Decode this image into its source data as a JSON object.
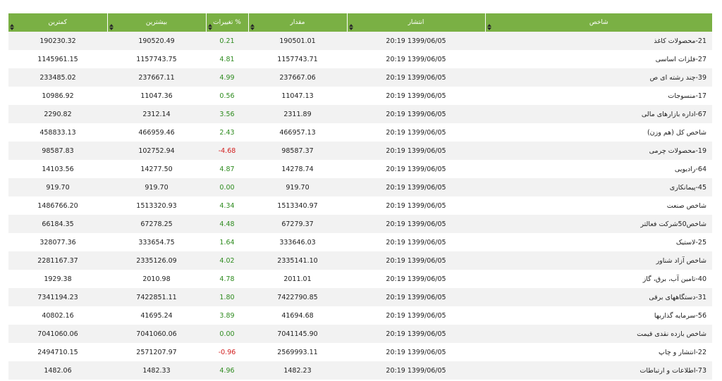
{
  "colors": {
    "header_bg": "#7ab044",
    "header_text": "#ffffff",
    "row_odd": "#f2f2f2",
    "row_even": "#ffffff",
    "positive": "#2e8b1f",
    "negative": "#d21f1f"
  },
  "table": {
    "headers": {
      "name": "شاخص",
      "published": "انتشار",
      "value": "مقدار",
      "change": "% تغییرات",
      "max": "بیشترین",
      "min": "کمترین"
    },
    "rows": [
      {
        "name": "21-محصولات کاغذ",
        "published": "20:19 1399/06/05",
        "value": "190501.01",
        "change": "0.21",
        "trend": "pos",
        "max": "190520.49",
        "min": "190230.32"
      },
      {
        "name": "27-فلزات اساسی",
        "published": "20:19 1399/06/05",
        "value": "1157743.71",
        "change": "4.81",
        "trend": "pos",
        "max": "1157743.75",
        "min": "1145961.15"
      },
      {
        "name": "39-چند رشته ای ص",
        "published": "20:19 1399/06/05",
        "value": "237667.06",
        "change": "4.99",
        "trend": "pos",
        "max": "237667.11",
        "min": "233485.02"
      },
      {
        "name": "17-منسوجات",
        "published": "20:19 1399/06/05",
        "value": "11047.13",
        "change": "0.56",
        "trend": "pos",
        "max": "11047.36",
        "min": "10986.92"
      },
      {
        "name": "67-اداره بازارهای مالی",
        "published": "20:19 1399/06/05",
        "value": "2311.89",
        "change": "3.56",
        "trend": "pos",
        "max": "2312.14",
        "min": "2290.82"
      },
      {
        "name": "شاخص کل (هم وزن)",
        "published": "20:19 1399/06/05",
        "value": "466957.13",
        "change": "2.43",
        "trend": "pos",
        "max": "466959.46",
        "min": "458833.13"
      },
      {
        "name": "19-محصولات چرمی",
        "published": "20:19 1399/06/05",
        "value": "98587.37",
        "change": "4.68-",
        "trend": "neg",
        "max": "102752.94",
        "min": "98587.83"
      },
      {
        "name": "64-رادیویی",
        "published": "20:19 1399/06/05",
        "value": "14278.74",
        "change": "4.87",
        "trend": "pos",
        "max": "14277.50",
        "min": "14103.56"
      },
      {
        "name": "45-پیمانکاری",
        "published": "20:19 1399/06/05",
        "value": "919.70",
        "change": "0.00",
        "trend": "zero",
        "max": "919.70",
        "min": "919.70"
      },
      {
        "name": "شاخص صنعت",
        "published": "20:19 1399/06/05",
        "value": "1513340.97",
        "change": "4.34",
        "trend": "pos",
        "max": "1513320.93",
        "min": "1486766.20"
      },
      {
        "name": "شاخص50شرکت فعالتر",
        "published": "20:19 1399/06/05",
        "value": "67279.37",
        "change": "4.48",
        "trend": "pos",
        "max": "67278.25",
        "min": "66184.35"
      },
      {
        "name": "25-لاستیک",
        "published": "20:19 1399/06/05",
        "value": "333646.03",
        "change": "1.64",
        "trend": "pos",
        "max": "333654.75",
        "min": "328077.36"
      },
      {
        "name": "شاخص آزاد شناور",
        "published": "20:19 1399/06/05",
        "value": "2335141.10",
        "change": "4.02",
        "trend": "pos",
        "max": "2335126.09",
        "min": "2281167.37"
      },
      {
        "name": "40-تامین آب، برق، گاز",
        "published": "20:19 1399/06/05",
        "value": "2011.01",
        "change": "4.78",
        "trend": "pos",
        "max": "2010.98",
        "min": "1929.38"
      },
      {
        "name": "31-دستگاههای برقی",
        "published": "20:19 1399/06/05",
        "value": "7422790.85",
        "change": "1.80",
        "trend": "pos",
        "max": "7422851.11",
        "min": "7341194.23"
      },
      {
        "name": "56-سرمایه گذاریها",
        "published": "20:19 1399/06/05",
        "value": "41694.68",
        "change": "3.89",
        "trend": "pos",
        "max": "41695.24",
        "min": "40802.16"
      },
      {
        "name": "شاخص بازده نقدی قیمت",
        "published": "20:19 1399/06/05",
        "value": "7041145.90",
        "change": "0.00",
        "trend": "zero",
        "max": "7041060.06",
        "min": "7041060.06"
      },
      {
        "name": "22-انتشار و چاپ",
        "published": "20:19 1399/06/05",
        "value": "2569993.11",
        "change": "0.96-",
        "trend": "neg",
        "max": "2571207.97",
        "min": "2494710.15"
      },
      {
        "name": "73-اطلاعات و ارتباطات",
        "published": "20:19 1399/06/05",
        "value": "1482.23",
        "change": "4.96",
        "trend": "pos",
        "max": "1482.33",
        "min": "1482.06"
      }
    ]
  }
}
